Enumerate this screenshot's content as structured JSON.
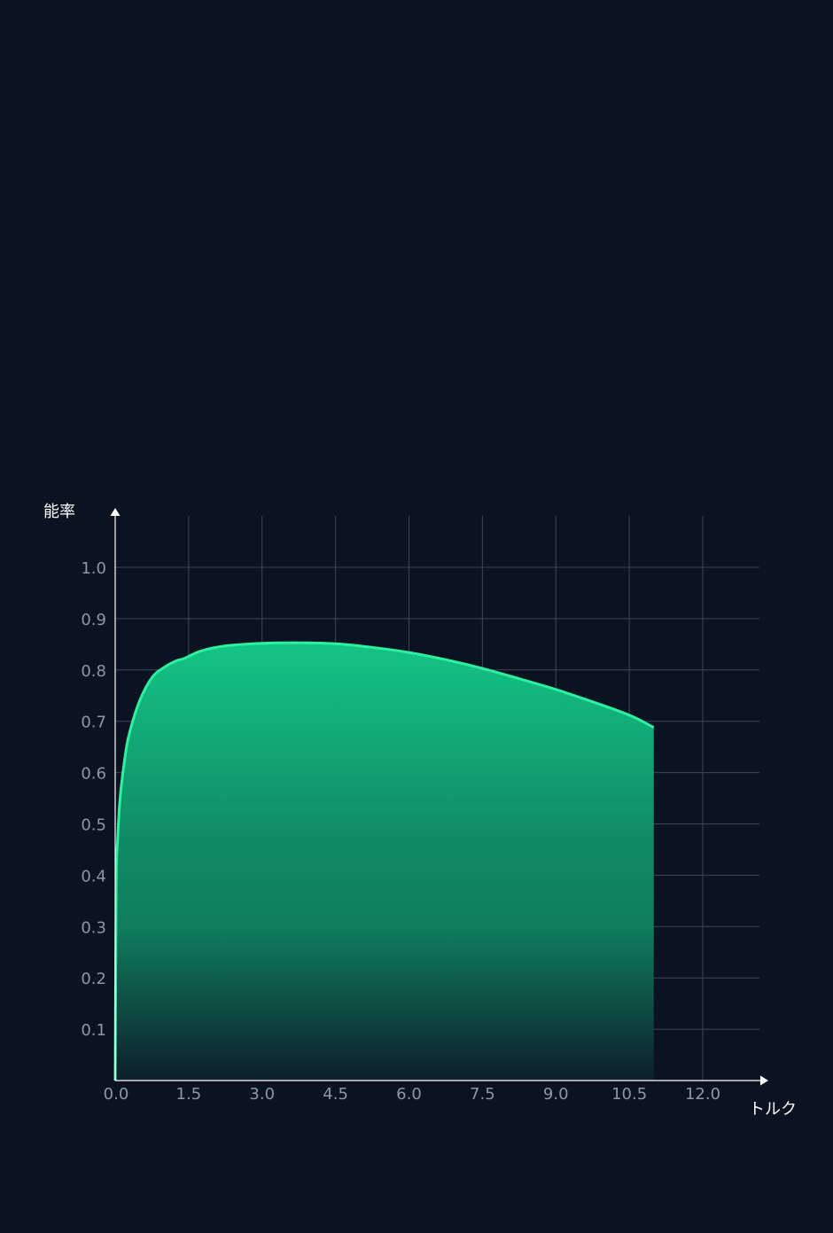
{
  "chart_data": {
    "type": "area",
    "title": "",
    "xlabel": "トルク",
    "ylabel": "能率",
    "xlim": [
      0,
      13.5
    ],
    "ylim": [
      0,
      1.1
    ],
    "grid": true,
    "x_ticks": [
      0.0,
      1.5,
      3.0,
      4.5,
      6.0,
      7.5,
      9.0,
      10.5,
      12.0
    ],
    "x_tick_labels": [
      "0.0",
      "1.5",
      "3.0",
      "4.5",
      "6.0",
      "7.5",
      "9.0",
      "10.5",
      "12.0"
    ],
    "y_ticks": [
      0.1,
      0.2,
      0.3,
      0.4,
      0.5,
      0.6,
      0.7,
      0.8,
      0.9,
      1.0
    ],
    "y_tick_labels": [
      "0.1",
      "0.2",
      "0.3",
      "0.4",
      "0.5",
      "0.6",
      "0.7",
      "0.8",
      "0.9",
      "1.0"
    ],
    "series": [
      {
        "x": [
          0.0,
          0.02,
          0.05,
          0.1,
          0.2,
          0.3,
          0.5,
          0.75,
          1.0,
          1.25,
          1.4,
          1.75,
          2.25,
          3.0,
          3.75,
          4.5,
          5.25,
          6.0,
          6.75,
          7.5,
          8.25,
          9.0,
          9.75,
          10.5,
          11.0
        ],
        "y": [
          0.0,
          0.38,
          0.47,
          0.55,
          0.63,
          0.68,
          0.74,
          0.785,
          0.805,
          0.818,
          0.822,
          0.837,
          0.847,
          0.852,
          0.853,
          0.851,
          0.844,
          0.834,
          0.82,
          0.803,
          0.783,
          0.762,
          0.738,
          0.712,
          0.688
        ],
        "color": "#2cf2a0"
      }
    ],
    "colors": {
      "background": "#0b1322",
      "line": "#2cf2a0",
      "fill_top": "#14c486",
      "fill_mid": "#108b65",
      "fill_bottom": "#0d1f2c",
      "grid": "#3c4656",
      "axis": "#ffffff",
      "tick_text": "#8f96a3",
      "title_text": "#ffffff"
    }
  }
}
